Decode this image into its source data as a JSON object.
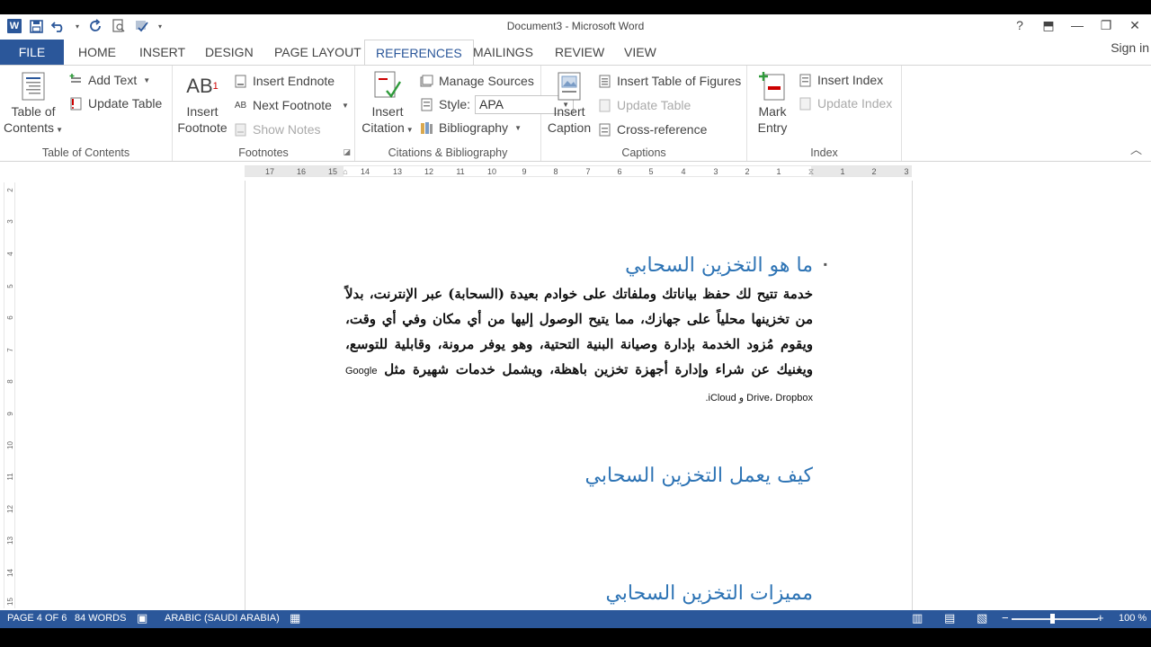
{
  "window": {
    "title": "Document3 - Microsoft Word",
    "sign_in": "Sign in",
    "buttons": {
      "help": "?",
      "restore_ribbon": "⬒",
      "minimize": "—",
      "restore": "❐",
      "close": "✕"
    }
  },
  "tabs": [
    "FILE",
    "HOME",
    "INSERT",
    "DESIGN",
    "PAGE LAYOUT",
    "REFERENCES",
    "MAILINGS",
    "REVIEW",
    "VIEW"
  ],
  "active_tab": "REFERENCES",
  "ribbon": {
    "toc": {
      "table_of_contents_l1": "Table of",
      "table_of_contents_l2": "Contents",
      "add_text": "Add Text",
      "update_table": "Update Table",
      "label": "Table of Contents"
    },
    "footnotes": {
      "insert_footnote_l1": "Insert",
      "insert_footnote_l2": "Footnote",
      "insert_endnote": "Insert Endnote",
      "next_footnote": "Next Footnote",
      "show_notes": "Show Notes",
      "label": "Footnotes"
    },
    "citations": {
      "insert_citation_l1": "Insert",
      "insert_citation_l2": "Citation",
      "manage_sources": "Manage Sources",
      "style_label": "Style:",
      "style_value": "APA",
      "bibliography": "Bibliography",
      "label": "Citations & Bibliography"
    },
    "captions": {
      "insert_caption_l1": "Insert",
      "insert_caption_l2": "Caption",
      "insert_table_of_figures": "Insert Table of Figures",
      "update_table": "Update Table",
      "cross_reference": "Cross-reference",
      "label": "Captions"
    },
    "index": {
      "mark_entry_l1": "Mark",
      "mark_entry_l2": "Entry",
      "insert_index": "Insert Index",
      "update_index": "Update Index",
      "label": "Index"
    }
  },
  "ruler": {
    "ticks": [
      "17",
      "16",
      "15",
      "14",
      "13",
      "12",
      "11",
      "10",
      "9",
      "8",
      "7",
      "6",
      "5",
      "4",
      "3",
      "2",
      "1",
      "1",
      "2",
      "3"
    ],
    "vticks": [
      "2",
      "3",
      "4",
      "5",
      "6",
      "7",
      "8",
      "9",
      "10",
      "11",
      "12",
      "13",
      "14",
      "15"
    ]
  },
  "document": {
    "heading1": "ما هو التخزين السحابي",
    "paragraph1_main": "خدمة تتيح لك حفظ بياناتك وملفاتك على خوادم بعيدة (السحابة) عبر الإنترنت، بدلاً من تخزينها محلياً على جهازك، مما يتيح الوصول إليها من أي مكان وفي أي وقت، ويقوم مُزود الخدمة بإدارة وصيانة البنية التحتية، وهو يوفر مرونة، وقابلية للتوسع، ويغنيك عن شراء وإدارة أجهزة تخزين باهظة، ويشمل خدمات شهيرة مثل",
    "paragraph1_services": "Google Drive، Dropbox و iCloud.",
    "heading2": "كيف يعمل التخزين السحابي",
    "heading3": "مميزات التخزين السحابي"
  },
  "status": {
    "page": "PAGE 4 OF 6",
    "words": "84 WORDS",
    "language": "ARABIC (SAUDI ARABIA)",
    "zoom": "100 %",
    "zoom_minus": "−",
    "zoom_plus": "+"
  }
}
